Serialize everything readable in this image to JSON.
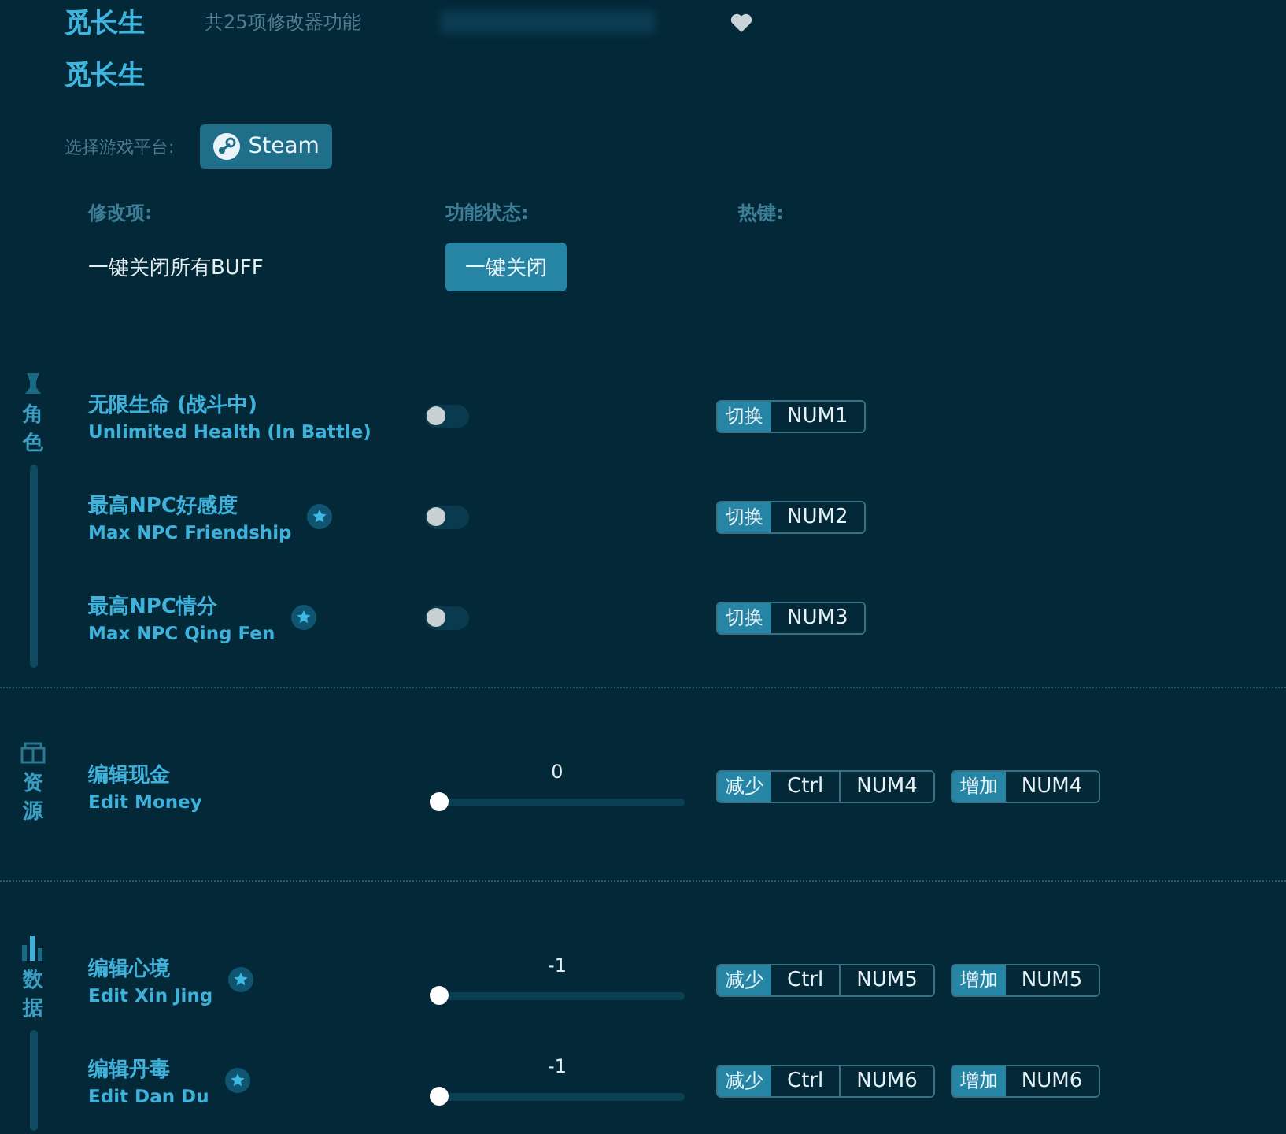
{
  "title": "觅长生",
  "subtitle": "共25项修改器功能",
  "title2": "觅长生",
  "platform": {
    "label": "选择游戏平台:",
    "options": [
      {
        "label": "Steam",
        "selected": true
      }
    ]
  },
  "headers": [
    "修改项:",
    "功能状态:",
    "热键:"
  ],
  "buff": {
    "label": "一键关闭所有BUFF",
    "button": "一键关闭"
  },
  "sections": [
    {
      "category": "角色",
      "rows": [
        {
          "kind": "toggle",
          "name": "无限生命 (战斗中)",
          "name_en": "Unlimited Health (In Battle)",
          "starred": false,
          "on": false,
          "hotkeys": [
            {
              "action": "切换",
              "keys": [
                "NUM1"
              ]
            }
          ]
        },
        {
          "kind": "toggle",
          "name": "最高NPC好感度",
          "name_en": "Max NPC Friendship",
          "starred": true,
          "on": false,
          "hotkeys": [
            {
              "action": "切换",
              "keys": [
                "NUM2"
              ]
            }
          ]
        },
        {
          "kind": "toggle",
          "name": "最高NPC情分",
          "name_en": "Max NPC Qing Fen",
          "starred": true,
          "on": false,
          "hotkeys": [
            {
              "action": "切换",
              "keys": [
                "NUM3"
              ]
            }
          ]
        }
      ]
    },
    {
      "category": "资源",
      "rows": [
        {
          "kind": "slider",
          "name": "编辑现金",
          "name_en": "Edit Money",
          "starred": false,
          "value": "0",
          "level": 0,
          "hotkeys": [
            {
              "action": "减少",
              "keys": [
                "Ctrl",
                "NUM4"
              ]
            },
            {
              "action": "增加",
              "keys": [
                "NUM4"
              ]
            }
          ]
        }
      ]
    },
    {
      "category": "数据",
      "rows": [
        {
          "kind": "slider",
          "name": "编辑心境",
          "name_en": "Edit Xin Jing",
          "starred": true,
          "value": "-1",
          "level": 0,
          "hotkeys": [
            {
              "action": "减少",
              "keys": [
                "Ctrl",
                "NUM5"
              ]
            },
            {
              "action": "增加",
              "keys": [
                "NUM5"
              ]
            }
          ]
        },
        {
          "kind": "slider",
          "name": "编辑丹毒",
          "name_en": "Edit Dan Du",
          "starred": true,
          "value": "-1",
          "level": 0,
          "hotkeys": [
            {
              "action": "减少",
              "keys": [
                "Ctrl",
                "NUM6"
              ]
            },
            {
              "action": "增加",
              "keys": [
                "NUM6"
              ]
            }
          ]
        }
      ]
    }
  ]
}
